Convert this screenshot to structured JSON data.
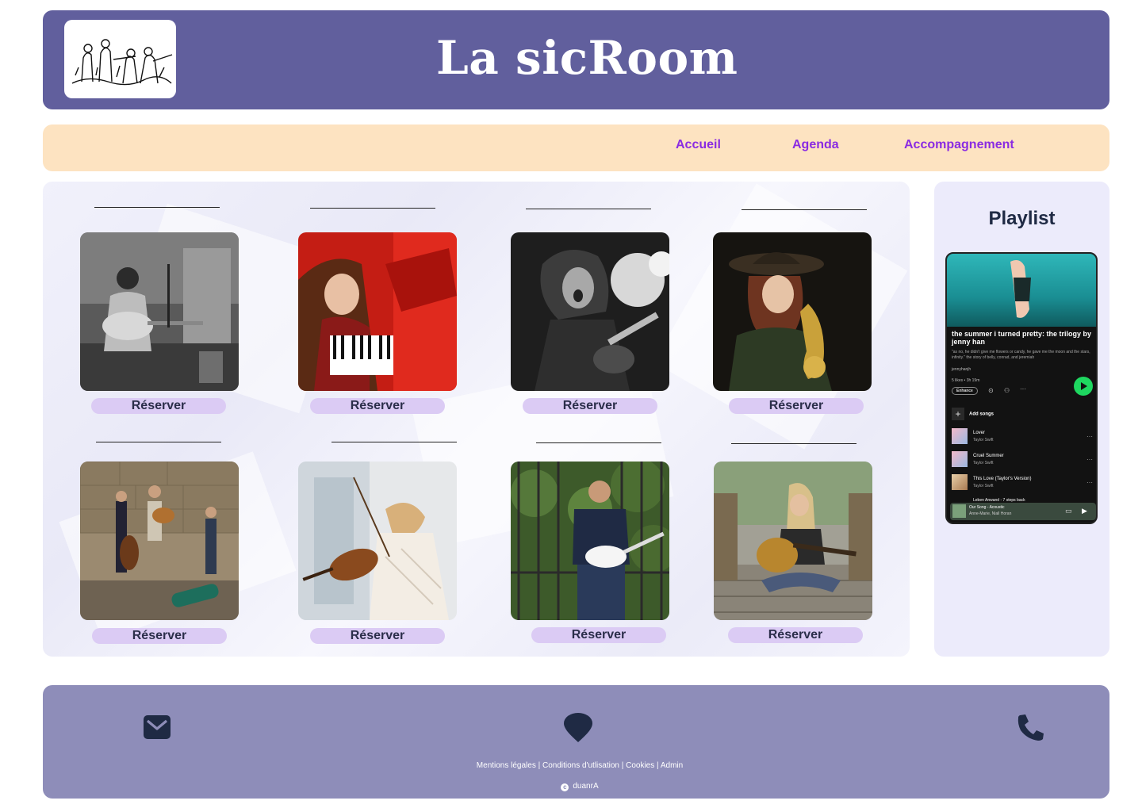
{
  "header": {
    "title": "La sicRoom",
    "logo_icon": "sketch-musicians-logo"
  },
  "nav": {
    "items": [
      "Accueil",
      "Agenda",
      "Accompagnement"
    ],
    "color": "#8a2be2"
  },
  "cards": [
    {
      "image": "guitarist-singer-photo",
      "button": "Réserver"
    },
    {
      "image": "pianist-red-piano-photo",
      "button": "Réserver"
    },
    {
      "image": "rock-guitarist-photo",
      "button": "Réserver"
    },
    {
      "image": "saxophonist-photo",
      "button": "Réserver"
    },
    {
      "image": "street-band-photo",
      "button": "Réserver"
    },
    {
      "image": "violinist-photo",
      "button": "Réserver"
    },
    {
      "image": "electric-guitarist-photo",
      "button": "Réserver"
    },
    {
      "image": "acoustic-guitarist-bridge-photo",
      "button": "Réserver"
    }
  ],
  "sidebar": {
    "title": "Playlist",
    "player": {
      "playlist_title": "the summer i turned pretty: the trilogy by jenny han",
      "description": "\"as no, he didn't give me flowers or candy, he gave me the moon and the stars, infinity.\" the story of belly, conrad, and jeremiah",
      "owner": "jennyhanjh",
      "meta": "5 likes • 3h 19m",
      "enhance_label": "Enhance",
      "add_songs_label": "Add songs",
      "tracks": [
        {
          "title": "Lover",
          "artist": "Taylor Swift"
        },
        {
          "title": "Cruel Summer",
          "artist": "Taylor Swift"
        },
        {
          "title": "This Love (Taylor's Version)",
          "artist": "Taylor Swift"
        }
      ],
      "partial_track": "Leben Anwand - 7 steps back",
      "now_playing": {
        "title": "Our Song - Acoustic",
        "artist": "Anne-Marie, Niall Horan"
      },
      "accent": "#1ed760"
    }
  },
  "footer": {
    "icons": [
      "envelope-icon",
      "map-pin-icon",
      "phone-icon"
    ],
    "legal": "Mentions légales | Conditions d'utlisation | Cookies | Admin",
    "copyright_symbol": "c",
    "copyright": "duanrA"
  },
  "colors": {
    "header": "#615f9d",
    "nav": "#fde3c1",
    "footer": "#8e8db9",
    "button": "#dbcbf4"
  }
}
